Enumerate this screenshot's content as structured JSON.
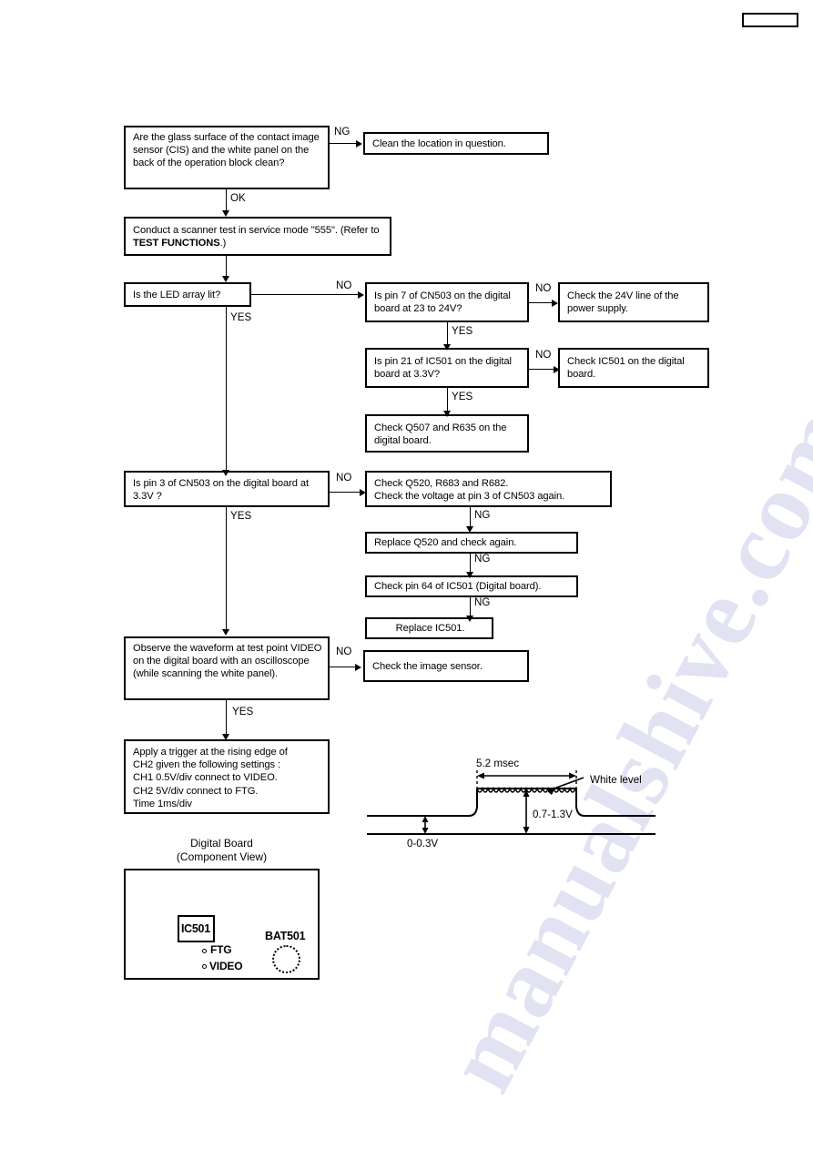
{
  "page": {
    "corner_box_label": "",
    "watermark_text": "manualshive.com"
  },
  "flowchart": {
    "nodes": [
      {
        "id": "cis-clean-check",
        "text": "Are the glass surface of the contact image sensor (CIS) and the white panel on the back of the operation block clean?"
      },
      {
        "id": "clean-location",
        "text": "Clean the location in question."
      },
      {
        "id": "scanner-test",
        "text_before": "Conduct a scanner test in service mode \"555\". (Refer to ",
        "text_bold": "TEST FUNCTIONS",
        "text_after": ".)"
      },
      {
        "id": "led-array-lit",
        "text": "Is the LED array lit?"
      },
      {
        "id": "pin7-cn503",
        "text": "Is pin 7 of CN503 on the digital board at 23 to 24V?"
      },
      {
        "id": "check-24v-line",
        "text": "Check the 24V line of the power supply."
      },
      {
        "id": "pin21-ic501",
        "text": "Is pin 21 of IC501 on the digital board at 3.3V?"
      },
      {
        "id": "check-ic501-digital",
        "text": "Check IC501 on the digital board."
      },
      {
        "id": "check-q507-r635",
        "text": "Check Q507 and R635 on the digital board."
      },
      {
        "id": "pin3-cn503",
        "text": "Is pin 3 of CN503 on the digital board at 3.3V ?"
      },
      {
        "id": "check-q520-r683-r682",
        "text": "Check Q520, R683 and R682.\nCheck the voltage at pin 3 of CN503 again."
      },
      {
        "id": "replace-q520",
        "text": "Replace Q520 and check again."
      },
      {
        "id": "check-pin64-ic501",
        "text": "Check pin 64 of IC501 (Digital board)."
      },
      {
        "id": "replace-ic501",
        "text": "Replace IC501."
      },
      {
        "id": "observe-waveform",
        "text": "Observe the waveform at test point VIDEO on the digital board with an oscilloscope (while scanning the white panel)."
      },
      {
        "id": "check-image-sensor",
        "text": "Check the image sensor."
      },
      {
        "id": "trigger-settings",
        "text": "Apply a trigger at the rising edge of\nCH2 given the following settings :\n    CH1    0.5V/div  connect to VIDEO.\n    CH2       5V/div  connect to FTG.\n    Time    1ms/div"
      }
    ],
    "branch_labels": {
      "ng_top": "NG",
      "ok": "OK",
      "no_led": "NO",
      "yes_led": "YES",
      "no_pin7": "NO",
      "yes_pin7": "YES",
      "no_pin21": "NO",
      "yes_pin21": "YES",
      "no_pin3": "NO",
      "yes_pin3": "YES",
      "ng_q520": "NG",
      "ng_replaceq520": "NG",
      "ng_pin64": "NG",
      "no_waveform": "NO",
      "yes_waveform": "YES"
    }
  },
  "waveform": {
    "duration_label": "5.2 msec",
    "white_level_label": "White level",
    "amplitude_label": "0.7-1.3V",
    "baseline_label": "0-0.3V"
  },
  "board": {
    "caption_line1": "Digital Board",
    "caption_line2": "(Component View)",
    "ic_label": "IC501",
    "testpoint_ftg": "FTG",
    "testpoint_video": "VIDEO",
    "battery_label": "BAT501"
  }
}
